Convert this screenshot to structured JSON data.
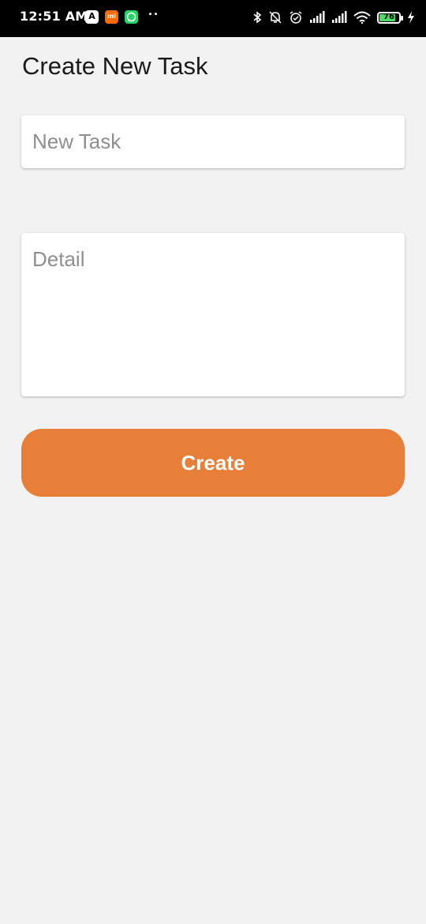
{
  "status_bar": {
    "time": "12:51 AM",
    "notification_icons": [
      "app-a-icon",
      "mi-icon",
      "whatsapp-icon"
    ],
    "more_indicator": "··",
    "system_icons": [
      "bluetooth-icon",
      "mute-icon",
      "alarm-icon",
      "signal-icon",
      "signal-icon",
      "wifi-icon"
    ],
    "battery_level": "76",
    "charging": true
  },
  "form": {
    "title": "Create New Task",
    "task_placeholder": "New Task",
    "detail_placeholder": "Detail",
    "submit_label": "Create"
  },
  "colors": {
    "accent": "#e87f38",
    "background": "#f2f2f2",
    "status_bar": "#000000"
  }
}
